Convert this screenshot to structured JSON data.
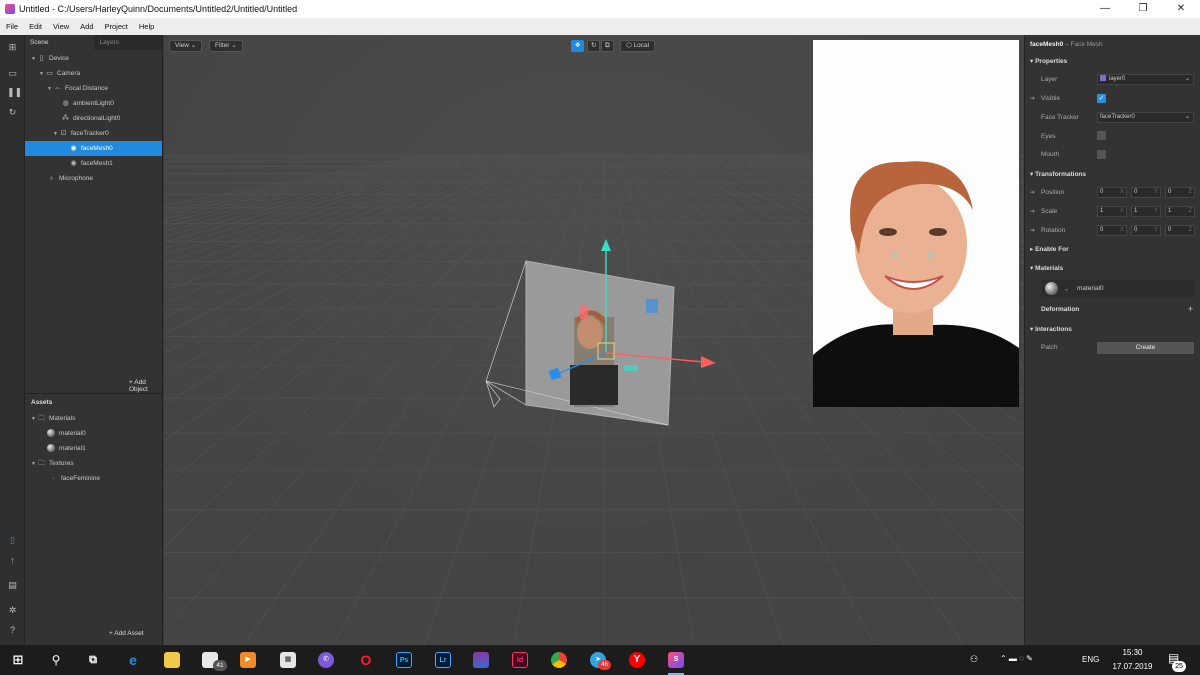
{
  "window": {
    "title": "Untitled - C:/Users/HarleyQuinn/Documents/Untitled2/Untitled/Untitled",
    "minimize": "—",
    "restore": "❐",
    "close": "✕"
  },
  "menu": [
    "File",
    "Edit",
    "View",
    "Add",
    "Project",
    "Help"
  ],
  "left_toolbar_icons": [
    "scene-icon",
    "camera-icon",
    "pause-icon",
    "refresh-icon",
    "add-device-icon",
    "upload-icon",
    "export-icon",
    "bug-icon",
    "help-icon"
  ],
  "scene": {
    "tab_scene": "Scene",
    "tab_layers": "Layers",
    "tree": [
      {
        "label": "Device",
        "icon": "device-icon"
      },
      {
        "label": "Camera",
        "icon": "camera-icon"
      },
      {
        "label": "Focal Distance",
        "icon": "focal-distance-icon"
      },
      {
        "label": "ambientLight0",
        "icon": "ambient-light-icon"
      },
      {
        "label": "directionalLight0",
        "icon": "directional-light-icon"
      },
      {
        "label": "faceTracker0",
        "icon": "face-tracker-icon"
      },
      {
        "label": "faceMesh0",
        "icon": "face-mesh-icon",
        "selected": true
      },
      {
        "label": "faceMesh1",
        "icon": "face-mesh-icon"
      },
      {
        "label": "Microphone",
        "icon": "microphone-icon"
      }
    ],
    "add_object": "+ Add Object"
  },
  "assets": {
    "title": "Assets",
    "tree": [
      {
        "label": "Materials",
        "icon": "folder-icon"
      },
      {
        "label": "material0",
        "icon": "material-sphere-icon"
      },
      {
        "label": "material1",
        "icon": "material-sphere-icon"
      },
      {
        "label": "Textures",
        "icon": "folder-icon"
      },
      {
        "label": "faceFeminine",
        "icon": "texture-icon"
      }
    ],
    "add_asset": "+ Add Asset"
  },
  "viewport": {
    "view_btn": "View",
    "filter_btn": "Filter",
    "local_btn": "Local"
  },
  "inspector": {
    "title": "faceMesh0",
    "subtitle": "– Face Mesh",
    "properties_header": "Properties",
    "layer_label": "Layer",
    "layer_value": "layer0",
    "visible_label": "Visible",
    "face_tracker_label": "Face Tracker",
    "face_tracker_value": "faceTracker0",
    "eyes_label": "Eyes",
    "mouth_label": "Mouth",
    "transformations_header": "Transformations",
    "position_label": "Position",
    "position": [
      "0",
      "0",
      "0"
    ],
    "scale_label": "Scale",
    "scale": [
      "1",
      "1",
      "1"
    ],
    "rotation_label": "Rotation",
    "rotation": [
      "0",
      "0",
      "0"
    ],
    "axis_labels": [
      "X",
      "Y",
      "Z"
    ],
    "enable_for_header": "Enable For",
    "materials_header": "Materials",
    "material_value": "material0",
    "deformation_header": "Deformation",
    "deformation_add": "+",
    "interactions_header": "Interactions",
    "patch_label": "Patch",
    "create_btn": "Create",
    "accent_color": "#2a8ee6",
    "layer_color": "#7b6fd6"
  },
  "taskbar": {
    "mail_badge": "41",
    "telegram_badge": "46",
    "lang": "ENG",
    "time": "15:30",
    "date": "17.07.2019",
    "notifications": "25",
    "apps": [
      "windows-start-icon",
      "search-icon",
      "task-view-icon",
      "edge-icon",
      "explorer-icon",
      "mail-icon",
      "media-player-icon",
      "store-icon",
      "viber-icon",
      "opera-icon",
      "photoshop-icon",
      "lightroom-icon",
      "winrar-icon",
      "indesign-icon",
      "chrome-icon",
      "telegram-icon",
      "yandex-icon",
      "spark-ar-icon"
    ],
    "app_labels": {
      "ps": "Ps",
      "lr": "Lr",
      "id": "Id"
    }
  }
}
